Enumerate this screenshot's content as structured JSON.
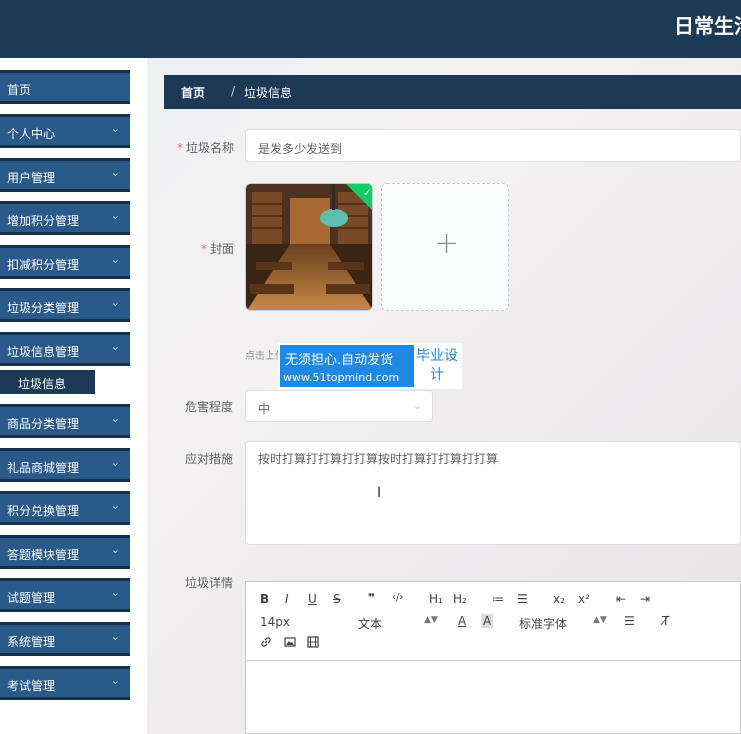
{
  "header": {
    "title": "日常生活"
  },
  "sidebar": {
    "items": [
      {
        "label": "首页",
        "has_chevron": false
      },
      {
        "label": "个人中心",
        "has_chevron": true
      },
      {
        "label": "用户管理",
        "has_chevron": true
      },
      {
        "label": "增加积分管理",
        "has_chevron": true
      },
      {
        "label": "扣减积分管理",
        "has_chevron": true
      },
      {
        "label": "垃圾分类管理",
        "has_chevron": true
      },
      {
        "label": "垃圾信息管理",
        "has_chevron": true
      },
      {
        "label": "商品分类管理",
        "has_chevron": true
      },
      {
        "label": "礼品商城管理",
        "has_chevron": true
      },
      {
        "label": "积分兑换管理",
        "has_chevron": true
      },
      {
        "label": "答题模块管理",
        "has_chevron": true
      },
      {
        "label": "试题管理",
        "has_chevron": true
      },
      {
        "label": "系统管理",
        "has_chevron": true
      },
      {
        "label": "考试管理",
        "has_chevron": true
      }
    ],
    "subitem": {
      "label": "垃圾信息"
    },
    "chevron_glyph": "⌄"
  },
  "breadcrumb": {
    "home": "首页",
    "separator": "/",
    "current": "垃圾信息"
  },
  "form": {
    "name": {
      "label": "垃圾名称",
      "value": "是发多少发送到"
    },
    "cover": {
      "label": "封面",
      "tip": "点击上传"
    },
    "danger": {
      "label": "危害程度",
      "value": "中"
    },
    "measures": {
      "label": "应对措施",
      "value": "按时打算打打算打打算按时打算打打算打打算"
    },
    "detail": {
      "label": "垃圾详情"
    }
  },
  "watermark": {
    "line1": "无须担心.自动发货",
    "line2": "www.51topmind.com",
    "side": "毕业设计"
  },
  "editor": {
    "toolbar_row1": [
      "B",
      "I",
      "U",
      "S",
      "❞",
      "‹/›",
      "H₁",
      "H₂",
      "≔",
      "☰",
      "x₂",
      "x²",
      "⇤",
      "⇥"
    ],
    "font_size": "14px",
    "text_style": "文本",
    "font_family": "标准字体",
    "align_glyph": "☰",
    "clear_glyph": "T̸",
    "color_glyph": "A",
    "bg_glyph": "A"
  },
  "colors": {
    "sidebar_bg": "#1c3a56",
    "menu_item": "#2a5a8a",
    "accent": "#1e88e5",
    "required": "#f56c6c"
  }
}
